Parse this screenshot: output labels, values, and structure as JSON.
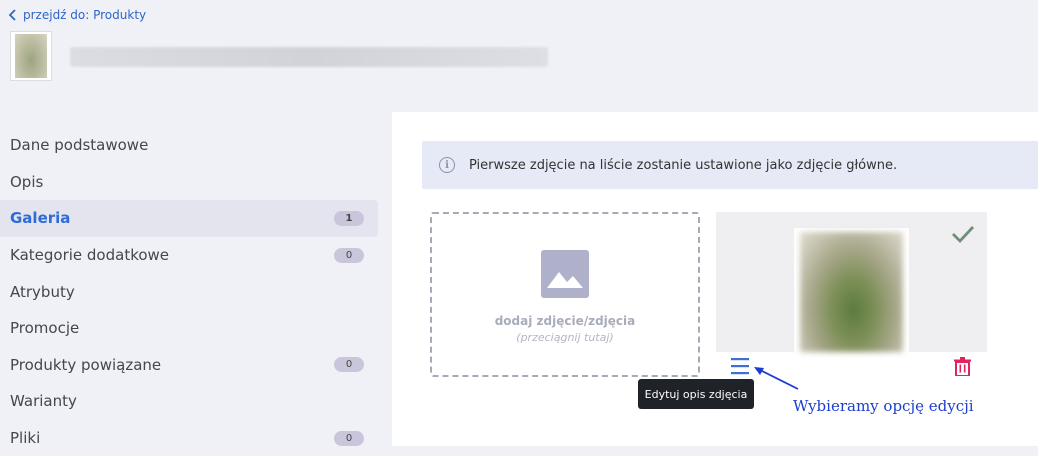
{
  "header": {
    "back_link": "przejdź do: Produkty"
  },
  "sidebar": {
    "items": [
      {
        "label": "Dane podstawowe",
        "badge": null
      },
      {
        "label": "Opis",
        "badge": null
      },
      {
        "label": "Galeria",
        "badge": "1",
        "active": true
      },
      {
        "label": "Kategorie dodatkowe",
        "badge": "0"
      },
      {
        "label": "Atrybuty",
        "badge": null
      },
      {
        "label": "Promocje",
        "badge": null
      },
      {
        "label": "Produkty powiązane",
        "badge": "0"
      },
      {
        "label": "Warianty",
        "badge": null
      },
      {
        "label": "Pliki",
        "badge": "0"
      }
    ]
  },
  "gallery": {
    "info_text": "Pierwsze zdjęcie na liście zostanie ustawione jako zdjęcie główne.",
    "dropzone_title": "dodaj zdjęcie/zdjęcia",
    "dropzone_hint": "(przeciągnij tutaj)",
    "tooltip": "Edytuj opis zdjęcia"
  },
  "annotation": {
    "text": "Wybieramy opcję edycji"
  },
  "colors": {
    "accent": "#2f6bd6",
    "trash": "#e0245e",
    "check": "#6f8f7a",
    "annotation": "#1c3ed0"
  },
  "icons": [
    "chevron-left-icon",
    "info-icon",
    "image-placeholder-icon",
    "check-icon",
    "menu-icon",
    "trash-icon"
  ]
}
